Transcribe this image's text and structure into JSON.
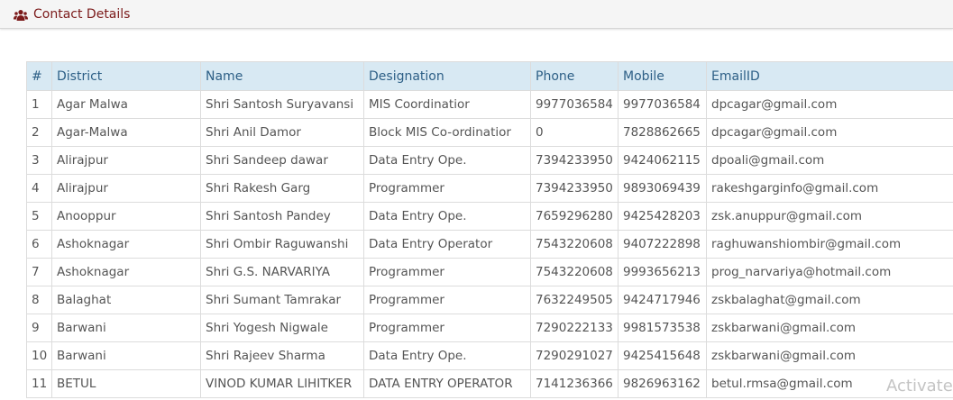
{
  "header": {
    "title": "Contact Details",
    "icon": "users-icon",
    "title_color": "#7b1a1a"
  },
  "table": {
    "header_color": "#d8e9f3",
    "columns": [
      "#",
      "District",
      "Name",
      "Designation",
      "Phone",
      "Mobile",
      "EmailID"
    ],
    "rows": [
      [
        "1",
        "Agar Malwa",
        "Shri Santosh Suryavansi",
        "MIS Coordinatior",
        "9977036584",
        "9977036584",
        "dpcagar@gmail.com"
      ],
      [
        "2",
        "Agar-Malwa",
        "Shri Anil Damor",
        "Block MIS Co-ordinatior",
        "0",
        "7828862665",
        "dpcagar@gmail.com"
      ],
      [
        "3",
        "Alirajpur",
        "Shri Sandeep dawar",
        "Data Entry Ope.",
        "7394233950",
        "9424062115",
        "dpoali@gmail.com"
      ],
      [
        "4",
        "Alirajpur",
        "Shri Rakesh Garg",
        "Programmer",
        "7394233950",
        "9893069439",
        "rakeshgarginfo@gmail.com"
      ],
      [
        "5",
        "Anooppur",
        "Shri Santosh Pandey",
        "Data Entry Ope.",
        "7659296280",
        "9425428203",
        "zsk.anuppur@gmail.com"
      ],
      [
        "6",
        "Ashoknagar",
        "Shri Ombir Raguwanshi",
        "Data Entry Operator",
        "7543220608",
        "9407222898",
        "raghuwanshiombir@gmail.com"
      ],
      [
        "7",
        "Ashoknagar",
        "Shri G.S. NARVARIYA",
        "Programmer",
        "7543220608",
        "9993656213",
        "prog_narvariya@hotmail.com"
      ],
      [
        "8",
        "Balaghat",
        "Shri Sumant Tamrakar",
        "Programmer",
        "7632249505",
        "9424717946",
        "zskbalaghat@gmail.com"
      ],
      [
        "9",
        "Barwani",
        "Shri Yogesh Nigwale",
        "Programmer",
        "7290222133",
        "9981573538",
        "zskbarwani@gmail.com"
      ],
      [
        "10",
        "Barwani",
        "Shri Rajeev Sharma",
        "Data Entry Ope.",
        "7290291027",
        "9425415648",
        "zskbarwani@gmail.com"
      ],
      [
        "11",
        "BETUL",
        "VINOD KUMAR LIHITKER",
        "DATA ENTRY OPERATOR",
        "7141236366",
        "9826963162",
        "betul.rmsa@gmail.com"
      ]
    ]
  },
  "watermark": {
    "text": "Activate"
  }
}
